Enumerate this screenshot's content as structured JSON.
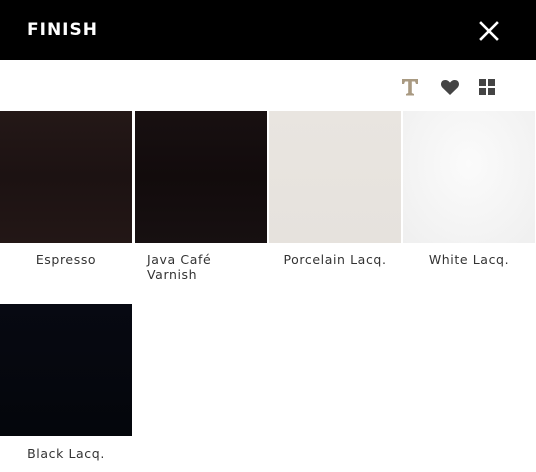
{
  "header": {
    "title": "FINISH",
    "close_icon": "close-icon"
  },
  "toolbar": {
    "items": [
      {
        "icon": "text-icon",
        "color": "#a99a82"
      },
      {
        "icon": "heart-icon",
        "color": "#444444"
      },
      {
        "icon": "grid-icon",
        "color": "#444444"
      }
    ]
  },
  "finishes": [
    {
      "label": "Espresso",
      "color": "#1f1413"
    },
    {
      "label": "Java Café Varnish",
      "color": "#150e0f"
    },
    {
      "label": "Porcelain Lacq.",
      "color": "#e8e4df"
    },
    {
      "label": "White Lacq.",
      "color": "#f6f6f6"
    },
    {
      "label": "Black Lacq.",
      "color": "#05070d"
    }
  ]
}
